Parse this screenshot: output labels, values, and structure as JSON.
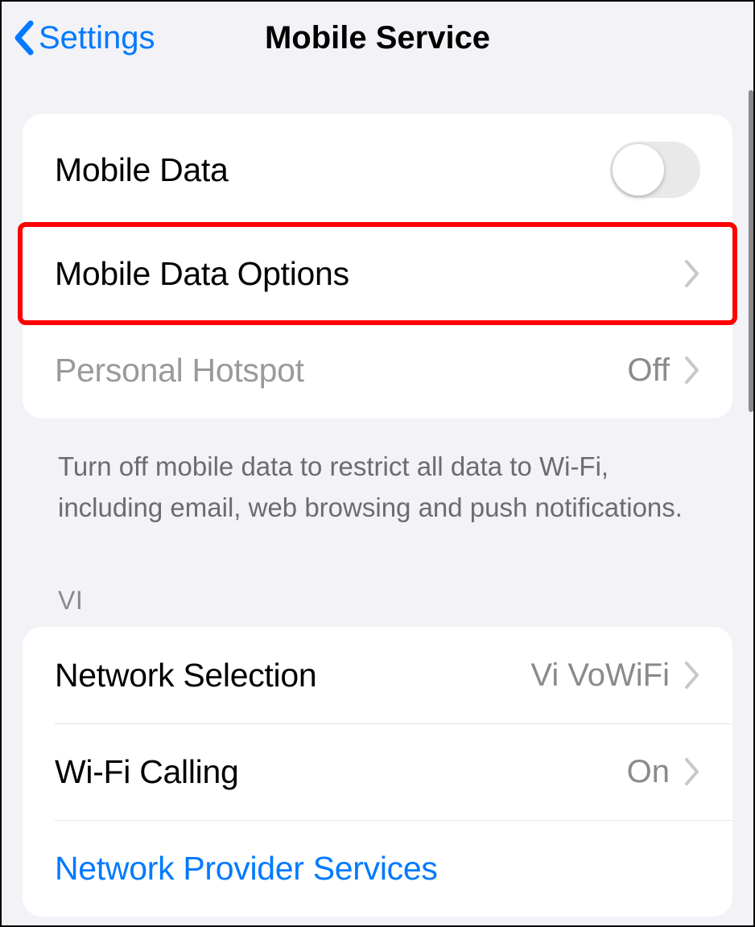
{
  "header": {
    "back_label": "Settings",
    "title": "Mobile Service"
  },
  "group1": {
    "mobile_data": {
      "label": "Mobile Data",
      "on": false
    },
    "mobile_data_options": {
      "label": "Mobile Data Options"
    },
    "personal_hotspot": {
      "label": "Personal Hotspot",
      "value": "Off"
    }
  },
  "footer1": "Turn off mobile data to restrict all data to Wi-Fi, including email, web browsing and push notifications.",
  "section2_header": "VI",
  "group2": {
    "network_selection": {
      "label": "Network Selection",
      "value": "Vi VoWiFi"
    },
    "wifi_calling": {
      "label": "Wi-Fi Calling",
      "value": "On"
    },
    "network_provider_services": {
      "label": "Network Provider Services"
    }
  }
}
